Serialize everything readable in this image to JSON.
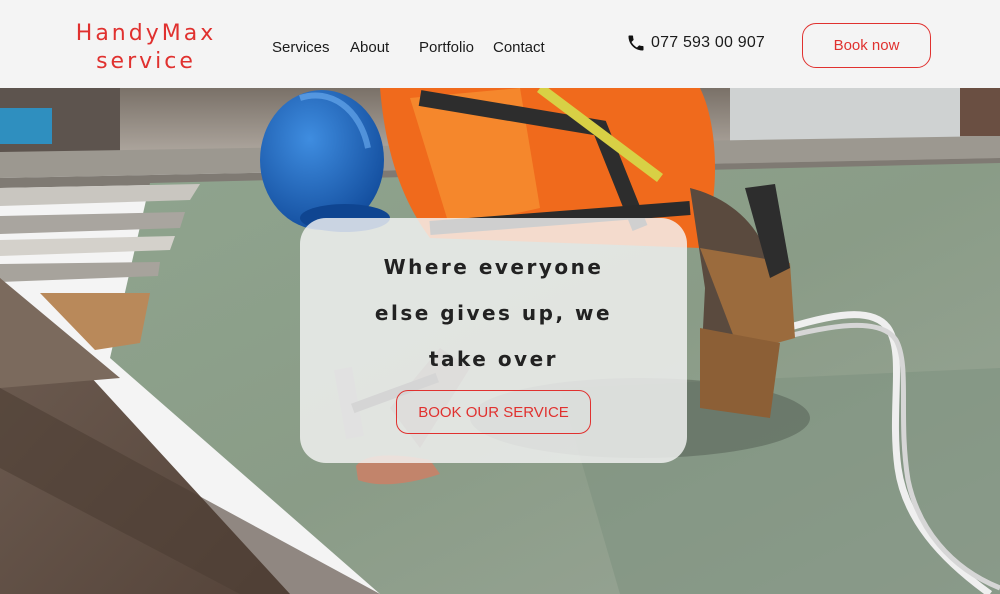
{
  "header": {
    "logo_line1": "HandyMax",
    "logo_line2": "service",
    "nav": [
      "Services",
      "About",
      "Portfolio",
      "Contact"
    ],
    "phone": "077 593 00 907",
    "book_now_label": "Book now"
  },
  "hero": {
    "title_line1": "Where everyone",
    "title_line2": "else gives up, we",
    "title_line3": "take over",
    "cta_label": "BOOK OUR SERVICE"
  },
  "colors": {
    "accent": "#e0312f",
    "header_bg": "#f4f4f4",
    "text": "#1b1b1b"
  },
  "icons": {
    "phone": "phone-icon"
  }
}
